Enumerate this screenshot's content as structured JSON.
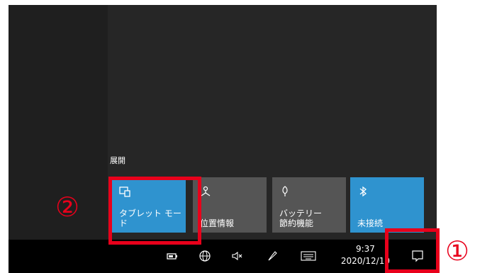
{
  "action_center": {
    "expand_label": "展開",
    "tiles": [
      {
        "label": "タブレット モード",
        "state": "on",
        "icon": "tablet-mode-icon"
      },
      {
        "label": "位置情報",
        "state": "off",
        "icon": "location-icon"
      },
      {
        "label": "バッテリー\n節約機能",
        "state": "off",
        "icon": "battery-saver-icon"
      },
      {
        "label": "未接続",
        "state": "on",
        "icon": "bluetooth-icon"
      }
    ]
  },
  "taskbar": {
    "time": "9:37",
    "date": "2020/12/10",
    "tray_icons": [
      "battery-icon",
      "network-globe-icon",
      "volume-muted-icon",
      "pen-icon",
      "touch-keyboard-icon"
    ],
    "notification_icon": "notification-icon"
  },
  "annotations": {
    "callout_1": "①",
    "callout_2": "②",
    "highlight_color": "#e8001b"
  },
  "colors": {
    "tile_on": "#2f93cf",
    "tile_off": "#555555",
    "taskbar": "#000000"
  }
}
